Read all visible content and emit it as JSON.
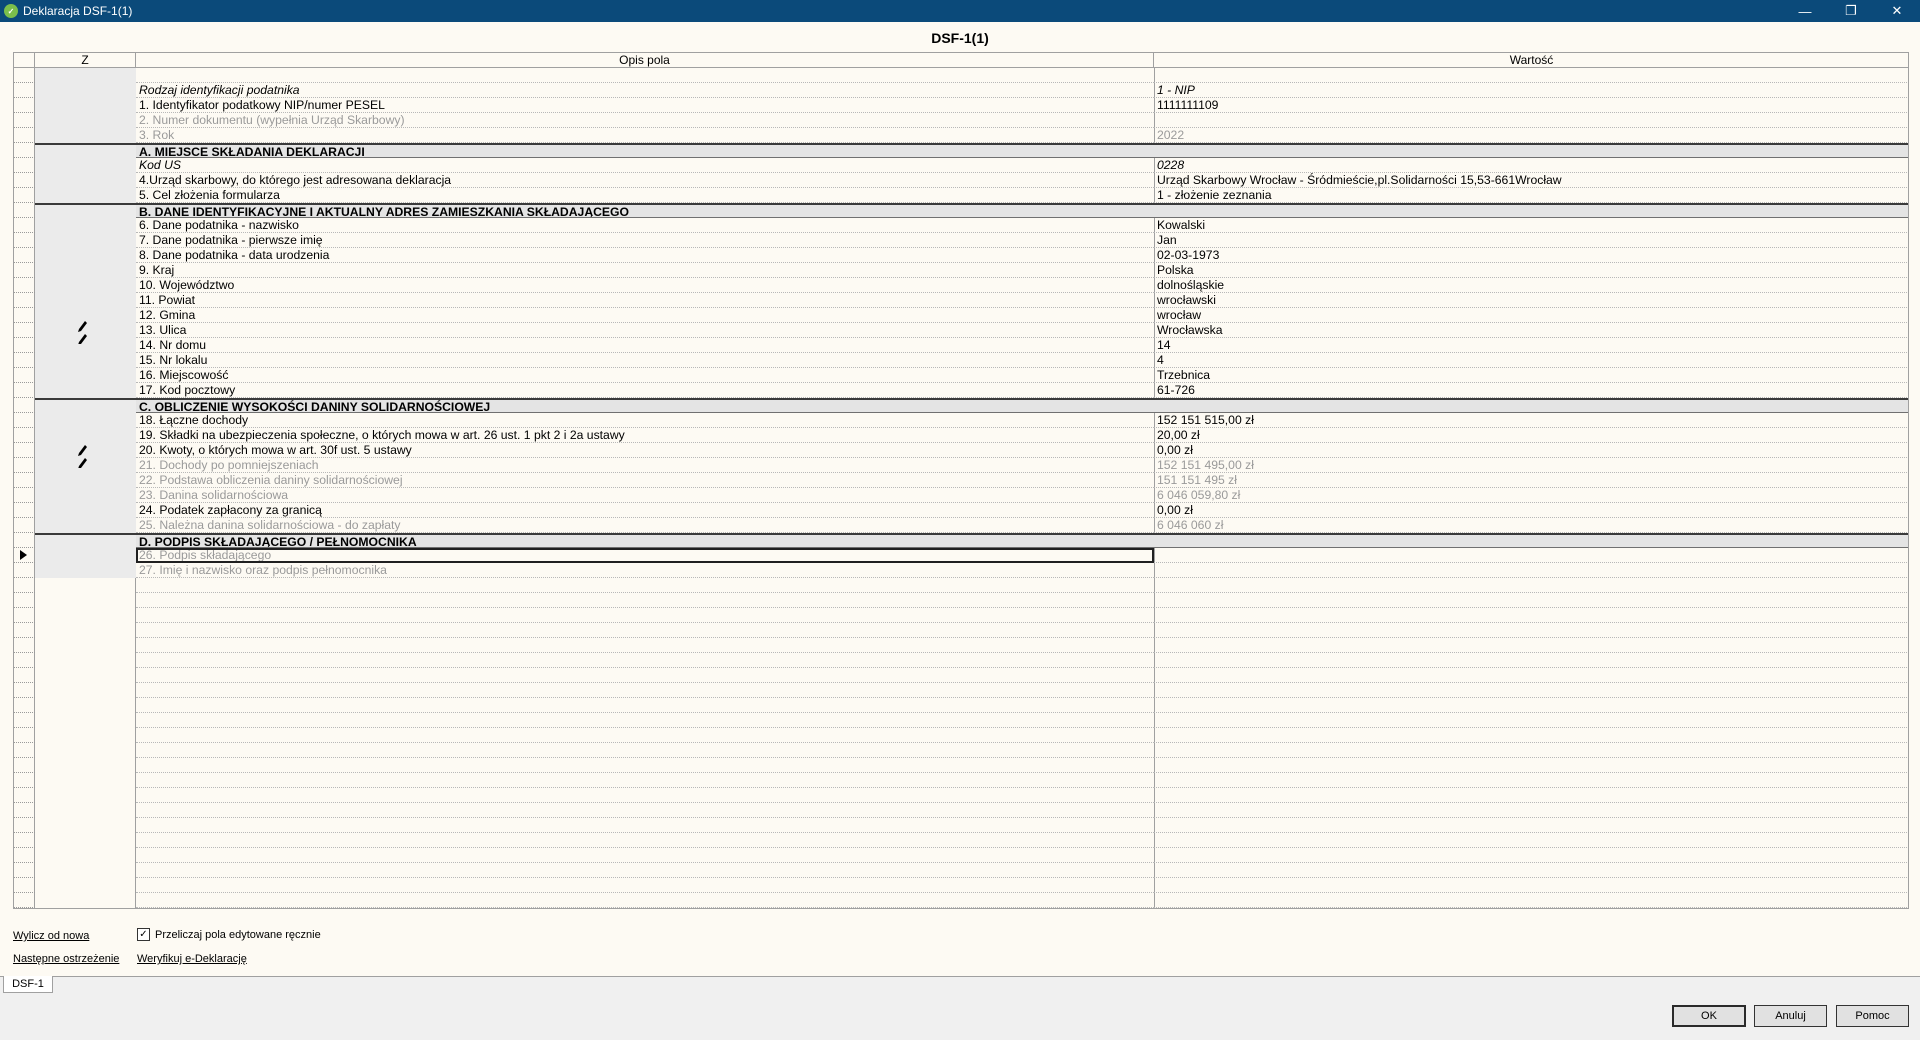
{
  "window": {
    "title": "Deklaracja DSF-1(1)",
    "icon": "app-icon",
    "controls": [
      "minimize-icon",
      "restore-icon",
      "close-icon"
    ]
  },
  "form": {
    "title": "DSF-1(1)"
  },
  "columns": {
    "z": "Z",
    "desc": "Opis pola",
    "value": "Wartość"
  },
  "rows": [
    {
      "type": "empty",
      "desc": "",
      "value": ""
    },
    {
      "type": "italic",
      "desc": "Rodzaj identyfikacji podatnika",
      "value": "1 - NIP"
    },
    {
      "type": "normal",
      "desc": "1. Identyfikator podatkowy NIP/numer PESEL",
      "value": "1111111109"
    },
    {
      "type": "disabled",
      "desc": "2. Numer dokumentu (wypełnia Urząd Skarbowy)",
      "value": ""
    },
    {
      "type": "disabled",
      "desc": "3. Rok",
      "value": "2022"
    },
    {
      "type": "header",
      "desc": "A. MIEJSCE SKŁADANIA DEKLARACJI",
      "value": ""
    },
    {
      "type": "italic",
      "desc": "Kod US",
      "value": "0228"
    },
    {
      "type": "normal",
      "desc": "4.Urząd skarbowy, do którego jest adresowana deklaracja",
      "value": "Urząd Skarbowy Wrocław - Śródmieście,pl.Solidarności 15,53-661Wrocław"
    },
    {
      "type": "normal",
      "desc": "5. Cel złożenia formularza",
      "value": "1 - złożenie zeznania"
    },
    {
      "type": "header",
      "desc": "B. DANE IDENTYFIKACYJNE I AKTUALNY ADRES ZAMIESZKANIA SKŁADAJĄCEGO",
      "value": ""
    },
    {
      "type": "normal",
      "desc": "6. Dane podatnika - nazwisko",
      "value": "Kowalski"
    },
    {
      "type": "normal",
      "desc": "7. Dane podatnika - pierwsze imię",
      "value": "Jan"
    },
    {
      "type": "normal",
      "desc": "8. Dane podatnika - data urodzenia",
      "value": "02-03-1973"
    },
    {
      "type": "normal",
      "desc": "9. Kraj",
      "value": "Polska"
    },
    {
      "type": "normal",
      "desc": "10. Województwo",
      "value": "dolnośląskie"
    },
    {
      "type": "normal",
      "desc": "11. Powiat",
      "value": "wrocławski"
    },
    {
      "type": "normal",
      "desc": "12. Gmina",
      "value": "wrocław"
    },
    {
      "type": "normal",
      "desc": "13. Ulica",
      "value": "Wrocławska"
    },
    {
      "type": "normal",
      "desc": "14. Nr domu",
      "value": "14"
    },
    {
      "type": "normal",
      "desc": "15. Nr lokalu",
      "value": "4"
    },
    {
      "type": "normal",
      "desc": "16. Miejscowość",
      "value": "Trzebnica"
    },
    {
      "type": "normal",
      "desc": "17. Kod pocztowy",
      "value": "61-726"
    },
    {
      "type": "header",
      "desc": "C. OBLICZENIE WYSOKOŚCI DANINY SOLIDARNOŚCIOWEJ",
      "value": ""
    },
    {
      "type": "normal",
      "desc": "18. Łączne dochody",
      "value": "152 151 515,00 zł"
    },
    {
      "type": "normal",
      "desc": "19. Składki na ubezpieczenia społeczne, o których mowa w art. 26 ust. 1 pkt 2 i 2a ustawy",
      "value": "20,00 zł"
    },
    {
      "type": "normal",
      "desc": "20. Kwoty, o których mowa w art. 30f ust. 5 ustawy",
      "value": "0,00 zł"
    },
    {
      "type": "disabled",
      "desc": "21. Dochody po pomniejszeniach",
      "value": "152 151 495,00 zł"
    },
    {
      "type": "disabled",
      "desc": "22. Podstawa obliczenia daniny solidarnościowej",
      "value": "151 151 495 zł"
    },
    {
      "type": "disabled",
      "desc": "23. Danina solidarnościowa",
      "value": "6 046 059,80 zł"
    },
    {
      "type": "normal",
      "desc": "24. Podatek zapłacony za granicą",
      "value": "0,00 zł"
    },
    {
      "type": "disabled",
      "desc": "25. Należna danina solidarnościowa - do zapłaty",
      "value": "6 046 060 zł"
    },
    {
      "type": "header",
      "desc": "D. PODPIS SKŁADAJĄCEGO / PEŁNOMOCNIKA",
      "value": ""
    },
    {
      "type": "disabled-current",
      "desc": "26. Podpis składającego",
      "value": ""
    },
    {
      "type": "disabled",
      "desc": "27. Imię i nazwisko oraz podpis pełnomocnika",
      "value": ""
    }
  ],
  "footer": {
    "recalc_link": "Wylicz od nowa",
    "next_warning_link": "Następne ostrzeżenie",
    "recalc_checkbox_label": "Przeliczaj pola edytowane ręcznie",
    "recalc_checkbox_checked": true,
    "verify_link": "Weryfikuj e-Deklarację"
  },
  "tabs": [
    {
      "label": "DSF-1"
    }
  ],
  "buttons": {
    "ok": "OK",
    "cancel": "Anuluj",
    "help": "Pomoc"
  }
}
